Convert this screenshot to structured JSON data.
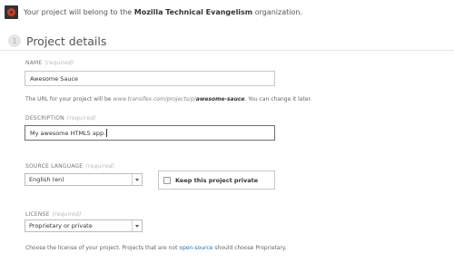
{
  "org": {
    "prefix": "Your project will belong to the",
    "name": "Mozilla Technical Evangelism",
    "suffix": "organization."
  },
  "section": {
    "step": "1",
    "title": "Project details"
  },
  "name_field": {
    "label": "NAME",
    "required": "(required)",
    "value": "Awesome Sauce"
  },
  "url_help": {
    "prefix": "The URL for your project will be",
    "base": "www.transifex.com/projects/p/",
    "slug": "awesome-sauce",
    "suffix": ". You can change it later."
  },
  "description_field": {
    "label": "DESCRIPTION",
    "required": "(required)",
    "value": "My awesome HTML5 app."
  },
  "source_language": {
    "label": "SOURCE LANGUAGE",
    "required": "(required)",
    "selected": "English (en)"
  },
  "private": {
    "label": "Keep this project private",
    "checked": false
  },
  "license": {
    "label": "LICENSE",
    "required": "(required)",
    "selected": "Proprietary or private"
  },
  "license_help": {
    "prefix": "Choose the license of your project. Projects that are not",
    "link": "open-source",
    "suffix": "should choose Proprietary."
  }
}
